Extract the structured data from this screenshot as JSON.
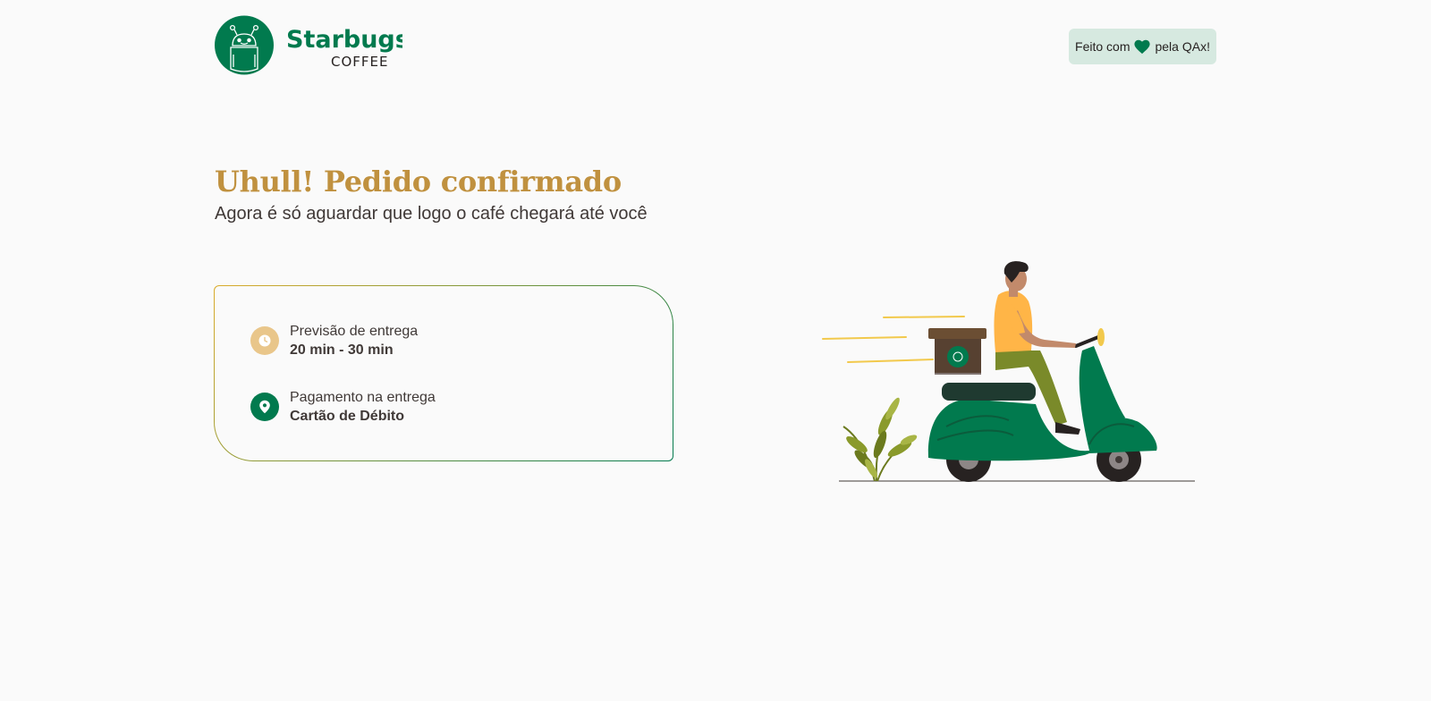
{
  "header": {
    "logo": {
      "brand_name": "Starbugs",
      "brand_sub": "COFFEE"
    },
    "badge": {
      "prefix": "Feito com",
      "icon": "heart-icon",
      "suffix": "pela QAx!"
    }
  },
  "main": {
    "title": "Uhull! Pedido confirmado",
    "subtitle": "Agora é só aguardar que logo o café chegará até você"
  },
  "order_info": [
    {
      "icon": "clock-icon",
      "label": "Previsão de entrega",
      "value": "20 min - 30 min"
    },
    {
      "icon": "map-pin-icon",
      "label": "Pagamento na entrega",
      "value": "Cartão de Débito"
    }
  ],
  "colors": {
    "brand_green": "#017A4E",
    "title_gold": "#C0913F",
    "badge_bg": "#D6E9E0",
    "clock_icon_bg": "#E9C68A",
    "text_dark": "#403937",
    "background": "#FAFAFA"
  }
}
